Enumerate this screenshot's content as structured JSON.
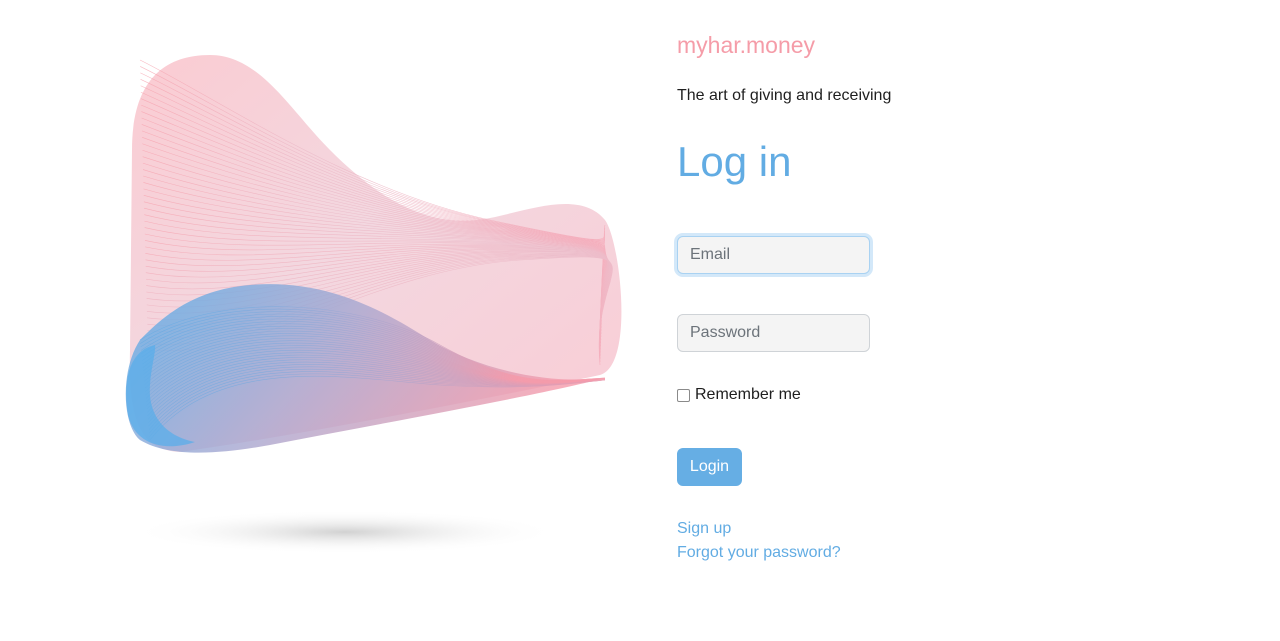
{
  "brand": {
    "name": "myhar.money",
    "tagline": "The art of giving and receiving"
  },
  "form": {
    "heading": "Log in",
    "email_placeholder": "Email",
    "password_placeholder": "Password",
    "remember_label": "Remember me",
    "remember_checked": false,
    "submit_label": "Login"
  },
  "links": {
    "signup": "Sign up",
    "forgot_password": "Forgot your password?"
  },
  "illustration": {
    "icon": "wave-ribbon-illustration",
    "colors": {
      "pink": "#f7a1ad",
      "blue": "#56aeea"
    }
  },
  "colors": {
    "brand": "#f59ca8",
    "accent": "#62ace3"
  }
}
